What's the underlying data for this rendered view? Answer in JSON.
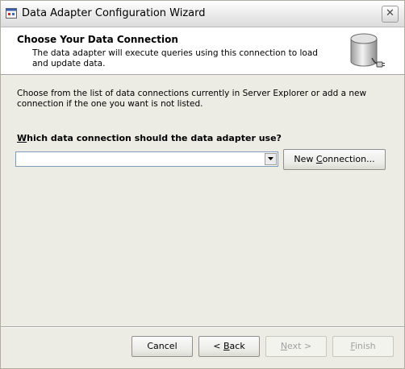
{
  "window": {
    "title": "Data Adapter Configuration Wizard",
    "close_glyph": "✕"
  },
  "header": {
    "title": "Choose Your Data Connection",
    "subtitle": "The data adapter will execute queries using this connection to load and update data.",
    "icon": "database-connection-icon"
  },
  "body": {
    "description": "Choose from the list of data connections currently in Server Explorer or add a new connection if the one you want is not listed.",
    "question_prefix": "W",
    "question_rest": "hich data connection should the data adapter use?",
    "connection_select": {
      "value": ""
    },
    "new_connection_button": {
      "prefix": "New ",
      "accel": "C",
      "rest": "onnection..."
    }
  },
  "footer": {
    "cancel": "Cancel",
    "back_prefix": "< ",
    "back_accel": "B",
    "back_rest": "ack",
    "next_prefix": "",
    "next_accel": "N",
    "next_rest": "ext >",
    "finish_accel": "F",
    "finish_rest": "inish"
  },
  "colors": {
    "dialog_bg": "#ecece4",
    "header_bg": "#ffffff",
    "combo_border": "#7f9db9",
    "disabled_text": "#a0a0a0"
  }
}
